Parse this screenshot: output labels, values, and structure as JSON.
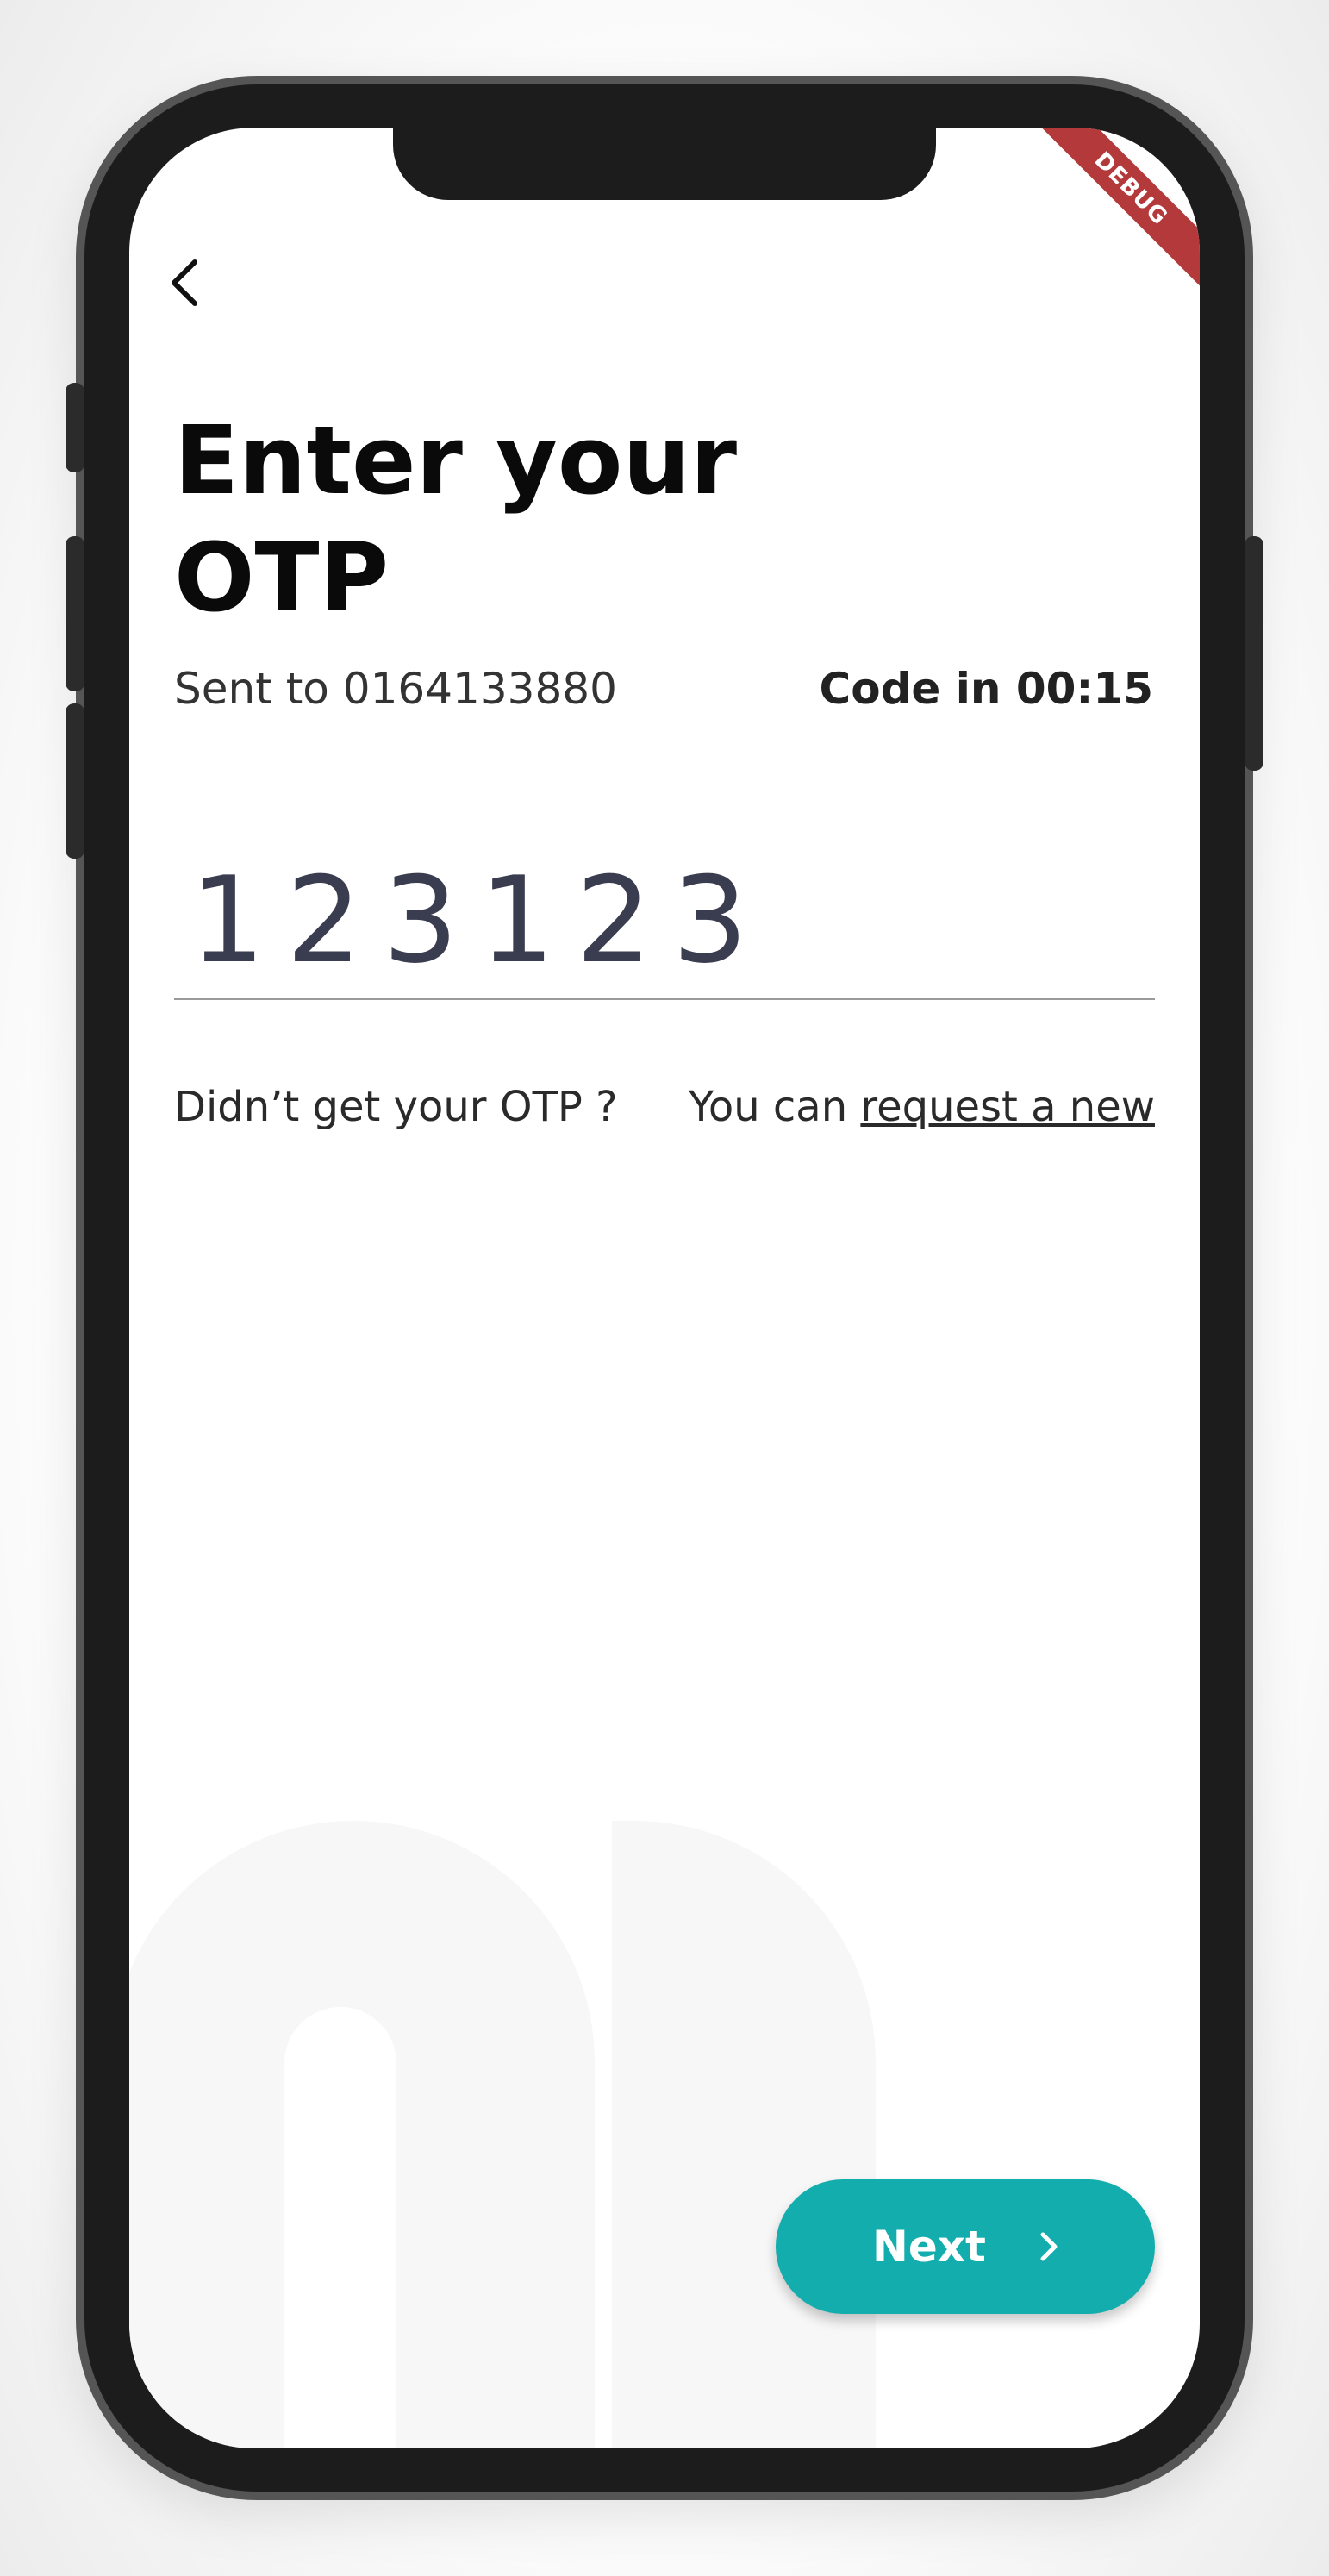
{
  "debug_banner": "DEBUG",
  "header": {
    "back_icon": "chevron-left-icon",
    "title_line1": "Enter your",
    "title_line2": "OTP"
  },
  "phone": {
    "sent_to": "Sent to 0164133880",
    "timer": "Code in 00:15"
  },
  "otp": {
    "digits": [
      "1",
      "2",
      "3",
      "1",
      "2",
      "3"
    ]
  },
  "resend": {
    "question": "Didn’t get your OTP ?",
    "prefix": "You can ",
    "link": "request a new"
  },
  "next_button": {
    "label": "Next",
    "icon": "chevron-right-icon",
    "color": "#13adad"
  }
}
